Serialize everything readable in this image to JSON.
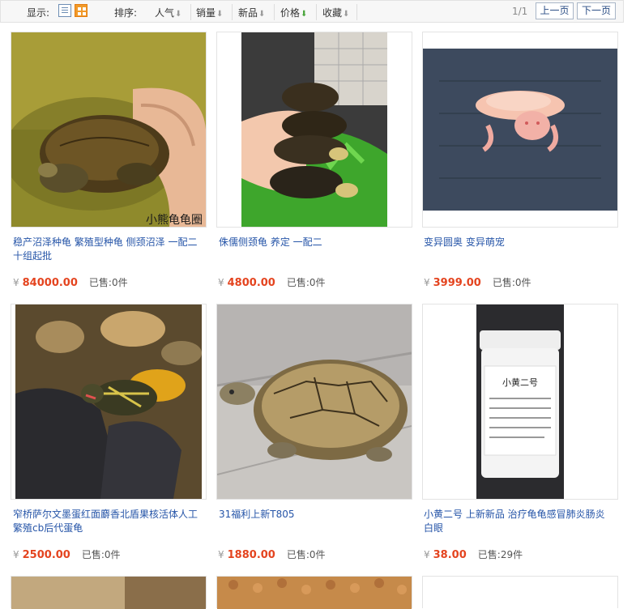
{
  "toolbar": {
    "display_label": "显示:",
    "sort_label": "排序:",
    "sort_options": [
      {
        "label": "人气",
        "active": false
      },
      {
        "label": "销量",
        "active": false
      },
      {
        "label": "新品",
        "active": false
      },
      {
        "label": "价格",
        "active": true
      },
      {
        "label": "收藏",
        "active": false
      }
    ],
    "page_count": "1/1",
    "prev_label": "上一页",
    "next_label": "下一页"
  },
  "products": [
    {
      "title": "稳产沼泽种龟 繁殖型种龟 侧颈沼泽 一配二十组起批",
      "price": "84000.00",
      "sold_label": "已售:",
      "sold": "0件",
      "image_caption": "小熊龟龟圈"
    },
    {
      "title": "侏儒侧颈龟 养定 一配二",
      "price": "4800.00",
      "sold_label": "已售:",
      "sold": "0件"
    },
    {
      "title": "变异圆奥 变异萌宠",
      "price": "3999.00",
      "sold_label": "已售:",
      "sold": "0件"
    },
    {
      "title": "窄桥萨尔文墨蛋红面麝香北盾果核活体人工繁殖cb后代蛋龟",
      "price": "2500.00",
      "sold_label": "已售:",
      "sold": "0件"
    },
    {
      "title": "31福利上新T805",
      "price": "1880.00",
      "sold_label": "已售:",
      "sold": "0件"
    },
    {
      "title": "小黄二号 上新新品 治疗龟龟感冒肺炎肠炎白眼",
      "price": "38.00",
      "sold_label": "已售:",
      "sold": "29件",
      "image_label": "小黄二号"
    }
  ],
  "currency_symbol": "¥",
  "colors": {
    "price": "#e4441f",
    "title_link": "#2655a8",
    "toolbar_bg": "#f7f7f7"
  }
}
